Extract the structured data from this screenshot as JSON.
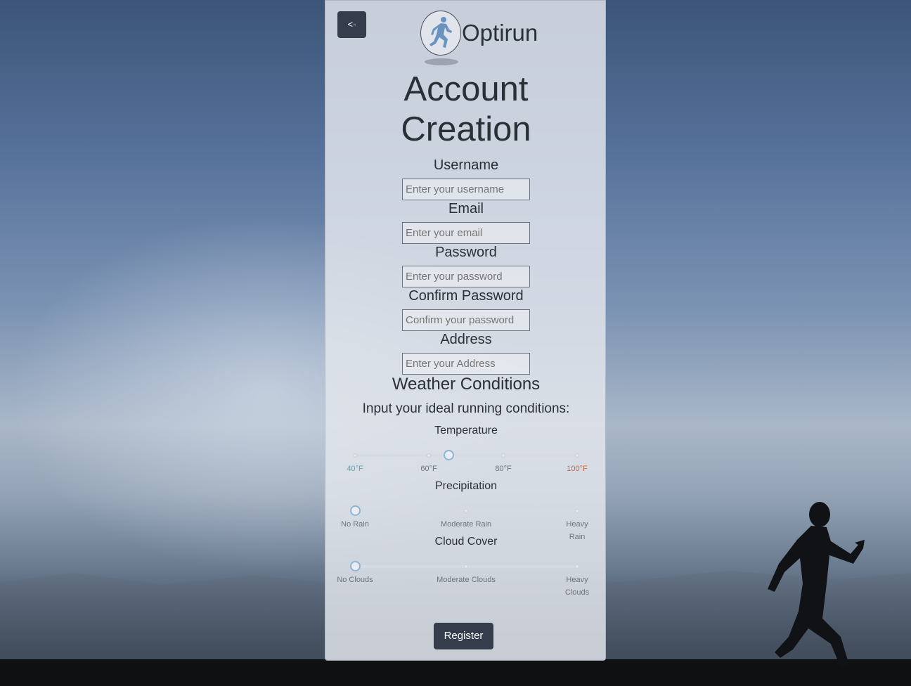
{
  "brand": {
    "name": "Optirun",
    "logo_icon": "runner-logo-icon"
  },
  "back_button": {
    "label": "<-"
  },
  "page_title": {
    "line1": "Account",
    "line2": "Creation"
  },
  "fields": [
    {
      "label": "Username",
      "placeholder": "Enter your username"
    },
    {
      "label": "Email",
      "placeholder": "Enter your email"
    },
    {
      "label": "Password",
      "placeholder": "Enter your password"
    },
    {
      "label": "Confirm Password",
      "placeholder": "Confirm your password"
    },
    {
      "label": "Address",
      "placeholder": "Enter your Address"
    }
  ],
  "weather": {
    "title": "Weather Conditions",
    "subtitle": "Input your ideal running conditions:",
    "temperature": {
      "title": "Temperature",
      "ticks": [
        "40°F",
        "60°F",
        "80°F",
        "100°F"
      ],
      "tick_colors": [
        "#6aa0a8",
        "#6d737c",
        "#6d737c",
        "#d0643a"
      ],
      "value_fraction": 0.42
    },
    "precipitation": {
      "title": "Precipitation",
      "ticks": [
        "No Rain",
        "Moderate Rain",
        "Heavy Rain"
      ],
      "value_fraction": 0
    },
    "cloud_cover": {
      "title": "Cloud Cover",
      "ticks": [
        "No Clouds",
        "Moderate Clouds",
        "Heavy Clouds"
      ],
      "value_fraction": 0
    }
  },
  "register_button": {
    "label": "Register"
  },
  "colors": {
    "button_bg": "#353d4c",
    "thumb_border": "#8fb4d2"
  }
}
